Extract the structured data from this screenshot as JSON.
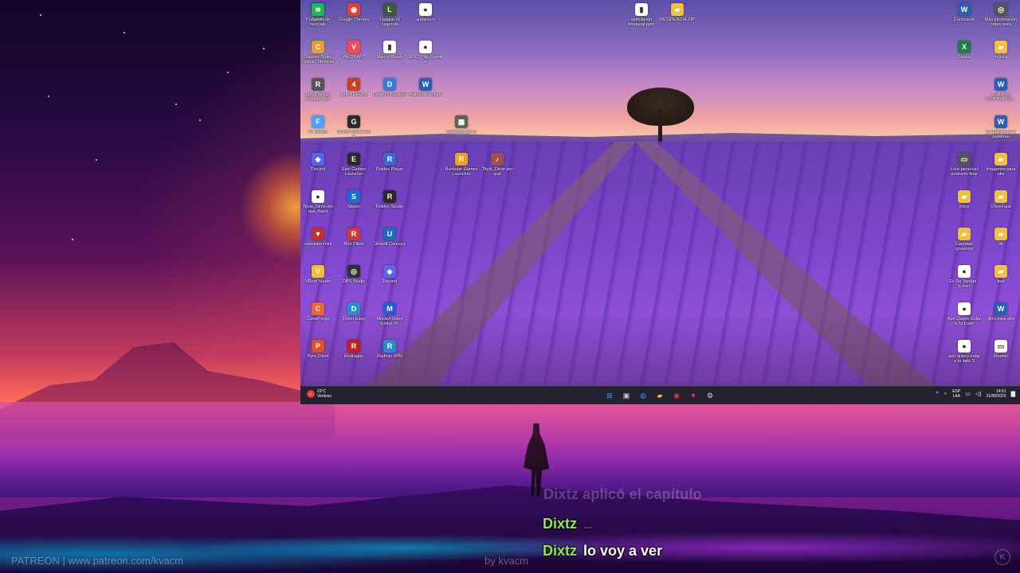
{
  "desktop": {
    "icons_left": [
      {
        "label": "Papelera de reciclaje",
        "color": "#4a90d9",
        "glyph": "♻"
      },
      {
        "label": "Google Chrome",
        "color": "#db4437",
        "glyph": "◉"
      },
      {
        "label": "League of Legends",
        "color": "#3a5a3a",
        "glyph": "L"
      },
      {
        "label": "audacium",
        "color": "#ffffff",
        "glyph": "●"
      },
      {
        "label": "Counter-Strike Global Offensive",
        "color": "#e0a030",
        "glyph": "C"
      },
      {
        "label": "VALORANT",
        "color": "#ff4655",
        "glyph": "V"
      },
      {
        "label": "Marvel Rivals",
        "color": "#ffffff",
        "glyph": "▮"
      },
      {
        "label": "EPIC_Tile_Fortnite",
        "color": "#ffffff",
        "glyph": "●"
      },
      {
        "label": "Tom Clancy's Rainbow Six",
        "color": "#555555",
        "glyph": "R"
      },
      {
        "label": "Left 4 Dead 2",
        "color": "#c84020",
        "glyph": "4"
      },
      {
        "label": "Dead by Daylight",
        "color": "#3a7ad0",
        "glyph": "D"
      },
      {
        "label": "Atajos de teclado",
        "color": "#2b5fb4",
        "glyph": "W"
      },
      {
        "label": "FL Studio",
        "color": "#4aa0ff",
        "glyph": "F"
      },
      {
        "label": "Grand Theft Auto V",
        "color": "#2a2a2a",
        "glyph": "G"
      },
      {
        "label": "Discord",
        "color": "#5865f2",
        "glyph": "◆"
      },
      {
        "label": "Epic Games Launcher",
        "color": "#2a2a2a",
        "glyph": "E"
      },
      {
        "label": "Roblox Player",
        "color": "#3a6ad0",
        "glyph": "R"
      },
      {
        "label": "Rockstar Games Launcher",
        "color": "#f0a020",
        "glyph": "R"
      },
      {
        "label": "Titulo_Dime por qué",
        "color": "#a05050",
        "glyph": "♪"
      },
      {
        "label": "Titulo_Dime por qué_Back",
        "color": "#ffffff",
        "glyph": "●"
      },
      {
        "label": "Steam",
        "color": "#1b6ad8",
        "glyph": "S"
      },
      {
        "label": "Roblox Studio",
        "color": "#2a2a2a",
        "glyph": "R"
      },
      {
        "label": "vadotube-mini",
        "color": "#c03030",
        "glyph": "▼"
      },
      {
        "label": "Riot Client",
        "color": "#d13639",
        "glyph": "R"
      },
      {
        "label": "Ubisoft Connect",
        "color": "#1a6ac0",
        "glyph": "U"
      },
      {
        "label": "VRoid Studio",
        "color": "#f0c030",
        "glyph": "V"
      },
      {
        "label": "OBS Studio",
        "color": "#303030",
        "glyph": "◎"
      },
      {
        "label": "Discord",
        "color": "#5865f2",
        "glyph": "◆"
      },
      {
        "label": "CurseForge",
        "color": "#f16436",
        "glyph": "C"
      },
      {
        "label": "Driver Easy",
        "color": "#2a8ad0",
        "glyph": "D"
      },
      {
        "label": "Movavi Video Editor 25",
        "color": "#2a5ad0",
        "glyph": "M"
      },
      {
        "label": "Pyro Client",
        "color": "#e05020",
        "glyph": "P"
      },
      {
        "label": "Redragon",
        "color": "#c02020",
        "glyph": "R"
      },
      {
        "label": "Radmin VPN",
        "color": "#2a8ad0",
        "glyph": "R"
      },
      {
        "label": "Spotify",
        "color": "#1db954",
        "glyph": "≋"
      }
    ],
    "icons_top_center": [
      {
        "label": "asimilando bloquear.pptx",
        "color": "#ffffff",
        "glyph": "▮"
      },
      {
        "label": "RESIDENCIA.ZIP",
        "color": "#f0c040",
        "glyph": "▰"
      }
    ],
    "icons_right": [
      {
        "label": "Curriculum",
        "color": "#2b5fb4",
        "glyph": "W"
      },
      {
        "label": "Más información sobre esta imagen",
        "color": "#555555",
        "glyph": "◎"
      },
      {
        "label": "Gastos",
        "color": "#1e7e45",
        "glyph": "X"
      },
      {
        "label": "música",
        "color": "#f0c040",
        "glyph": "▰"
      },
      {
        "label": "El mundo CONTRA CO...",
        "color": "#2b5fb4",
        "glyph": "W"
      },
      {
        "label": "El registro de 4 palabras",
        "color": "#2b5fb4",
        "glyph": "W"
      },
      {
        "label": "Lore personal producto final",
        "color": "#555555",
        "glyph": "▭"
      },
      {
        "label": "Imagenes para obs",
        "color": "#f0c040",
        "glyph": "▰"
      },
      {
        "label": "fotos",
        "color": "#f0c040",
        "glyph": "▰"
      },
      {
        "label": "VSeeFace",
        "color": "#f0c040",
        "glyph": "▰"
      },
      {
        "label": "Carpetas goooood",
        "color": "#f0c040",
        "glyph": "▰"
      },
      {
        "label": "lib",
        "color": "#f0c040",
        "glyph": "▰"
      },
      {
        "label": "Es De Verdad - Cover",
        "color": "#ffffff",
        "glyph": "●"
      },
      {
        "label": "text",
        "color": "#f0c040",
        "glyph": "▰"
      },
      {
        "label": "Aún Quiero Estar a Tu Lado",
        "color": "#ffffff",
        "glyph": "●"
      },
      {
        "label": "libro para ella",
        "color": "#2b5fb4",
        "glyph": "W"
      },
      {
        "label": "aun quiero estar a tu lado 2",
        "color": "#ffffff",
        "glyph": "●"
      },
      {
        "label": "Mueble",
        "color": "#ffffff",
        "glyph": "▭"
      }
    ],
    "icons_mid": [
      {
        "label": "Sistemas por si",
        "color": "#556655",
        "glyph": "▦"
      }
    ]
  },
  "taskbar": {
    "weather_temp": "23°C",
    "weather_text": "Ventoso",
    "apps": [
      {
        "name": "start-icon",
        "glyph": "⊞",
        "color": "#3aa0ff"
      },
      {
        "name": "task-view-icon",
        "glyph": "▣",
        "color": "#cccccc"
      },
      {
        "name": "edge-icon",
        "glyph": "◍",
        "color": "#2aa0e0"
      },
      {
        "name": "file-explorer-icon",
        "glyph": "▰",
        "color": "#f0c040"
      },
      {
        "name": "chrome-icon",
        "glyph": "◉",
        "color": "#db4437"
      },
      {
        "name": "vadotube-icon",
        "glyph": "▼",
        "color": "#d04040"
      },
      {
        "name": "settings-icon",
        "glyph": "⚙",
        "color": "#dddddd"
      }
    ],
    "lang_top": "ESP",
    "lang_bottom": "LAA",
    "time": "14:51",
    "date": "21/08/2025"
  },
  "subtitles": {
    "ghost": "Dixtz  aplicó el capítulo",
    "line1_name": "Dixtz",
    "line1_text": "...",
    "line2_name": "Dixtz",
    "line2_text": "lo voy a ver"
  },
  "watermarks": {
    "left": "PATREON | www.patreon.com/kvacm",
    "center": "by kvacm",
    "corner": "K"
  }
}
